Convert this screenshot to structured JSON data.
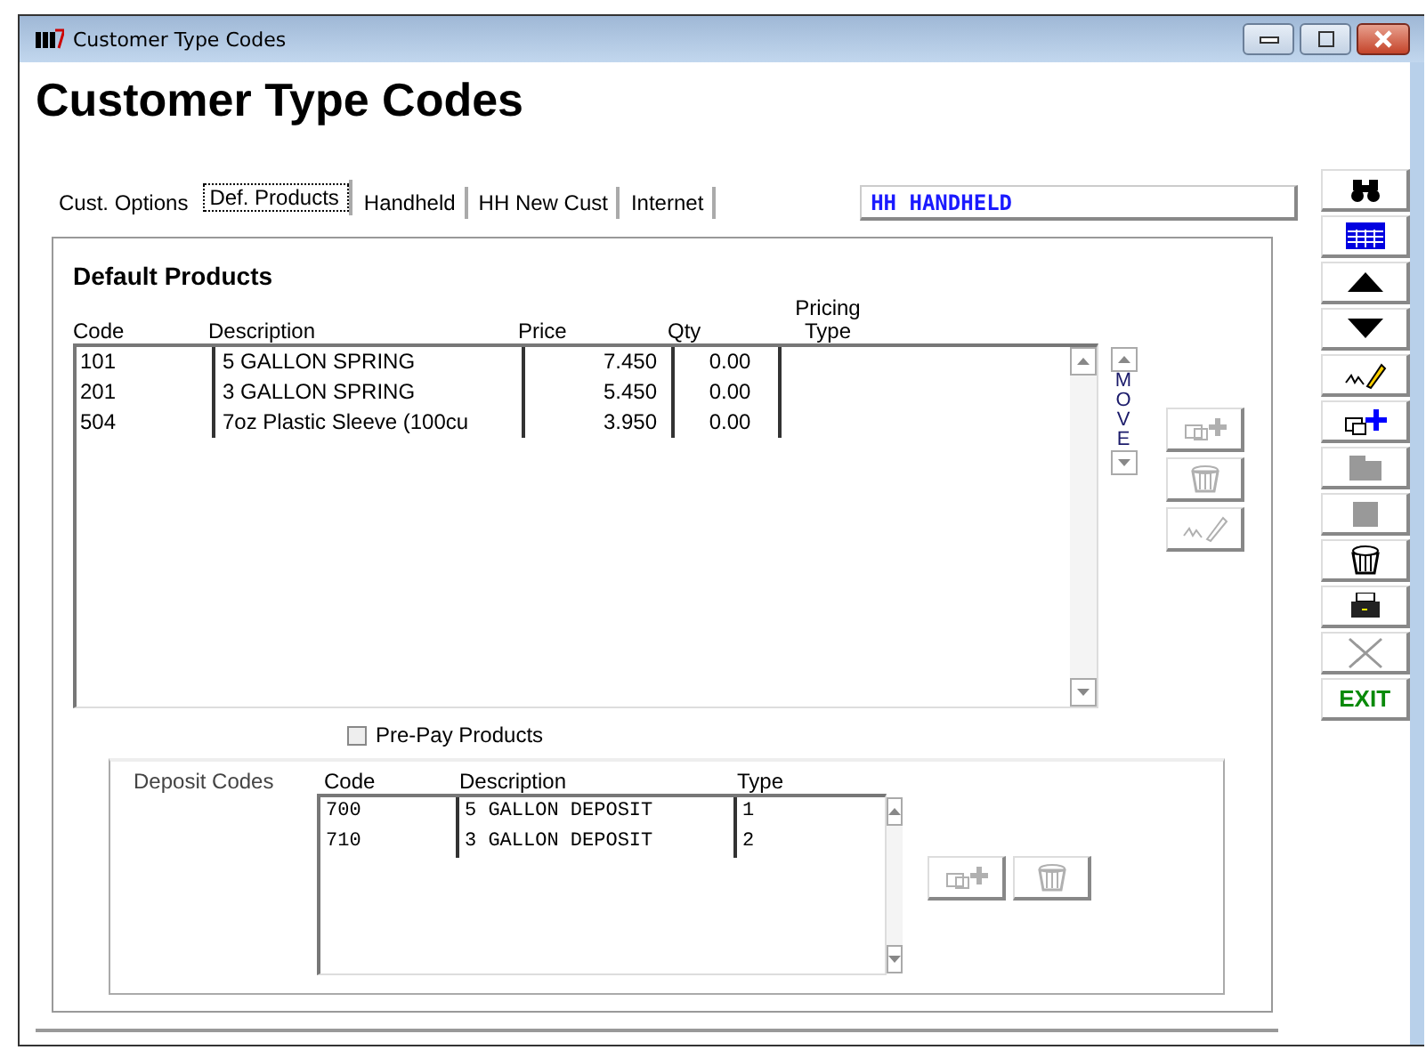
{
  "window": {
    "title": "Customer Type Codes"
  },
  "heading": "Customer Type Codes",
  "tabs": [
    {
      "label": "Cust. Options",
      "selected": false
    },
    {
      "label": "Def. Products",
      "selected": true
    },
    {
      "label": "Handheld",
      "selected": false
    },
    {
      "label": "HH New Cust",
      "selected": false
    },
    {
      "label": "Internet",
      "selected": false
    }
  ],
  "customer_type": "HH  HANDHELD",
  "section_title": "Default Products",
  "products": {
    "columns": [
      "Code",
      "Description",
      "Price",
      "Qty",
      "Pricing Type"
    ],
    "rows": [
      [
        "101",
        "5 GALLON SPRING",
        "7.450",
        "0.00",
        ""
      ],
      [
        "201",
        "3 GALLON SPRING",
        "5.450",
        "0.00",
        ""
      ],
      [
        "504",
        "7oz Plastic Sleeve (100cu",
        "3.950",
        "0.00",
        ""
      ]
    ]
  },
  "move_label": "MOVE",
  "product_buttons": [
    {
      "kind": "add",
      "disabled": true
    },
    {
      "kind": "delete",
      "disabled": true
    },
    {
      "kind": "edit",
      "disabled": true
    }
  ],
  "prepay": {
    "label": "Pre-Pay Products",
    "checked": false
  },
  "deposit": {
    "title": "Deposit Codes",
    "columns": [
      "Code",
      "Description",
      "Type"
    ],
    "rows": [
      [
        "700",
        "5 GALLON DEPOSIT",
        "1"
      ],
      [
        "710",
        "3 GALLON DEPOSIT",
        "2"
      ]
    ],
    "buttons": [
      {
        "kind": "add",
        "disabled": true
      },
      {
        "kind": "delete",
        "disabled": true
      }
    ]
  },
  "toolbar": [
    {
      "kind": "search",
      "disabled": false
    },
    {
      "kind": "grid",
      "disabled": false
    },
    {
      "kind": "up",
      "disabled": false
    },
    {
      "kind": "down",
      "disabled": false
    },
    {
      "kind": "edit",
      "disabled": false
    },
    {
      "kind": "add",
      "disabled": false
    },
    {
      "kind": "folder",
      "disabled": true
    },
    {
      "kind": "square",
      "disabled": true
    },
    {
      "kind": "delete",
      "disabled": false
    },
    {
      "kind": "print",
      "disabled": false
    },
    {
      "kind": "cancel",
      "disabled": true
    },
    {
      "kind": "exit",
      "label": "EXIT",
      "disabled": false
    }
  ]
}
